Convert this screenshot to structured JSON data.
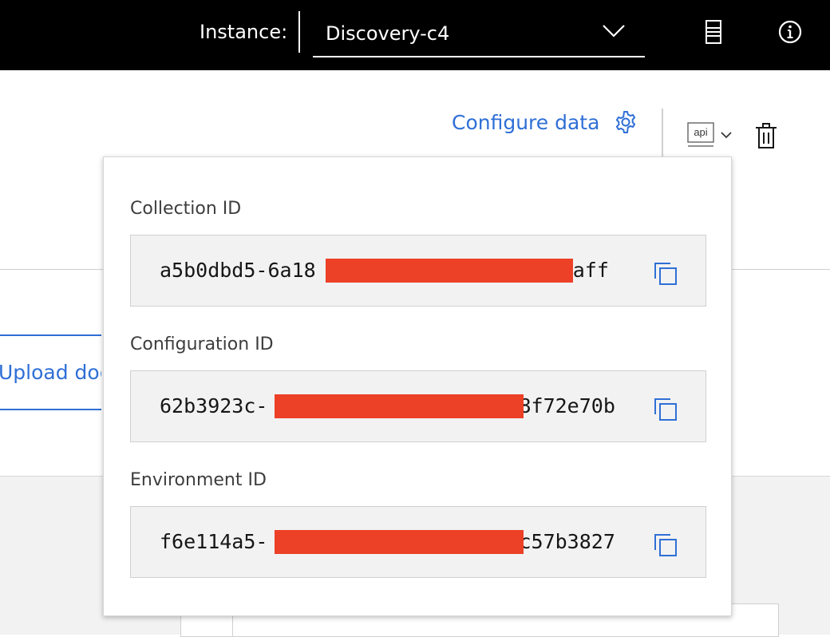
{
  "topbar": {
    "instance_label": "Instance:",
    "instance_value": "Discovery-c4",
    "icons": [
      "chevron-down-icon",
      "server-icon",
      "info-icon"
    ]
  },
  "toolbar": {
    "configure_label": "Configure data",
    "configure_icon": "gear-icon",
    "api_icon_text": "api",
    "delete_icon": "trash-icon"
  },
  "page": {
    "upload_label": "Upload doc"
  },
  "popover": {
    "fields": [
      {
        "label": "Collection ID",
        "prefix": "a5b0dbd5-6a18",
        "suffix": "aaff"
      },
      {
        "label": "Configuration ID",
        "prefix": "62b3923c-",
        "suffix": "8f72e70b"
      },
      {
        "label": "Environment ID",
        "prefix": "f6e114a5-",
        "suffix": "c57b3827"
      }
    ]
  },
  "colors": {
    "accent": "#2f6fd6",
    "topbar_bg": "#000000",
    "redaction": "#ec4027",
    "field_bg": "#f2f2f2"
  }
}
